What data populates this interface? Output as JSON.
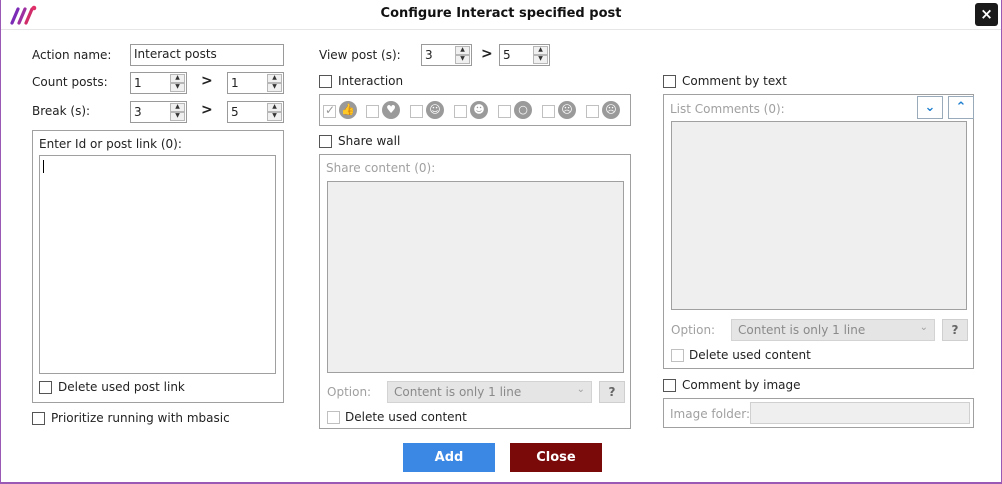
{
  "window": {
    "title": "Configure Interact specified post",
    "close_icon": "×"
  },
  "left": {
    "action_name_label": "Action name:",
    "action_name_value": "Interact posts",
    "count_posts_label": "Count posts:",
    "count_posts_from": "1",
    "count_posts_to": "1",
    "break_label": "Break (s):",
    "break_from": "3",
    "break_to": "5",
    "range_sep": ">",
    "enter_id_label": "Enter Id or post link (0):",
    "delete_used_post_link": "Delete used post link",
    "prioritize_mbasic": "Prioritize running with mbasic"
  },
  "middle": {
    "view_post_label": "View post (s):",
    "view_post_from": "3",
    "view_post_to": "5",
    "range_sep": ">",
    "interaction_label": "Interaction",
    "reactions": [
      {
        "name": "like-icon",
        "glyph": "👍",
        "checked": true
      },
      {
        "name": "love-icon",
        "glyph": "♥",
        "checked": false
      },
      {
        "name": "care-icon",
        "glyph": "☺",
        "checked": false
      },
      {
        "name": "haha-icon",
        "glyph": "☻",
        "checked": false
      },
      {
        "name": "wow-icon",
        "glyph": "○",
        "checked": false
      },
      {
        "name": "sad-icon",
        "glyph": "☹",
        "checked": false
      },
      {
        "name": "angry-icon",
        "glyph": "☹",
        "checked": false
      }
    ],
    "share_wall_label": "Share wall",
    "share_content_label": "Share content (0):",
    "option_label": "Option:",
    "option_value": "Content is only 1 line",
    "help_label": "?",
    "delete_used_content": "Delete used content"
  },
  "right": {
    "comment_by_text_label": "Comment by text",
    "list_comments_label": "List Comments (0):",
    "sort_down_icon": "⌄",
    "sort_up_icon": "⌃",
    "option_label": "Option:",
    "option_value": "Content is only 1 line",
    "help_label": "?",
    "delete_used_content": "Delete used content",
    "comment_by_image_label": "Comment by image",
    "image_folder_label": "Image folder:"
  },
  "footer": {
    "add_label": "Add",
    "close_label": "Close"
  },
  "colors": {
    "accent_border": "#9b59b6",
    "add_button": "#3b87e4",
    "close_button": "#7a0a0a"
  }
}
